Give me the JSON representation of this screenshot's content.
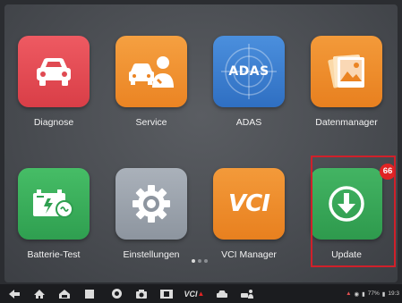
{
  "apps": {
    "diagnose": {
      "label": "Diagnose",
      "icon": "car-front-icon",
      "color": "#e04a52"
    },
    "service": {
      "label": "Service",
      "icon": "car-mechanic-icon",
      "color": "#f0902c"
    },
    "adas": {
      "label": "ADAS",
      "icon": "adas-target-icon",
      "color": "#3a7ed0",
      "icon_text": "ADAS"
    },
    "datenmanager": {
      "label": "Datenmanager",
      "icon": "photo-folder-icon",
      "color": "#f08a2a"
    },
    "batterie_test": {
      "label": "Batterie-Test",
      "icon": "battery-icon",
      "color": "#3ab05a"
    },
    "einstellungen": {
      "label": "Einstellungen",
      "icon": "gear-icon",
      "color": "#9aa2ac"
    },
    "vci_manager": {
      "label": "VCI Manager",
      "icon": "vci-logo-icon",
      "color": "#f08a2a",
      "icon_text": "VCI"
    },
    "update": {
      "label": "Update",
      "icon": "download-arrow-icon",
      "color": "#34a853",
      "badge": "66"
    }
  },
  "highlight_color": "#d0202a",
  "navbar": {
    "icons": [
      "back-icon",
      "home-icon",
      "car-home-icon",
      "recent-apps-icon",
      "browser-icon",
      "camera-icon",
      "screen-record-icon",
      "vci-status-icon",
      "car-icon",
      "mechanic-icon"
    ],
    "vci_label": "VCI",
    "status_text": "77%",
    "time": "19:3"
  }
}
